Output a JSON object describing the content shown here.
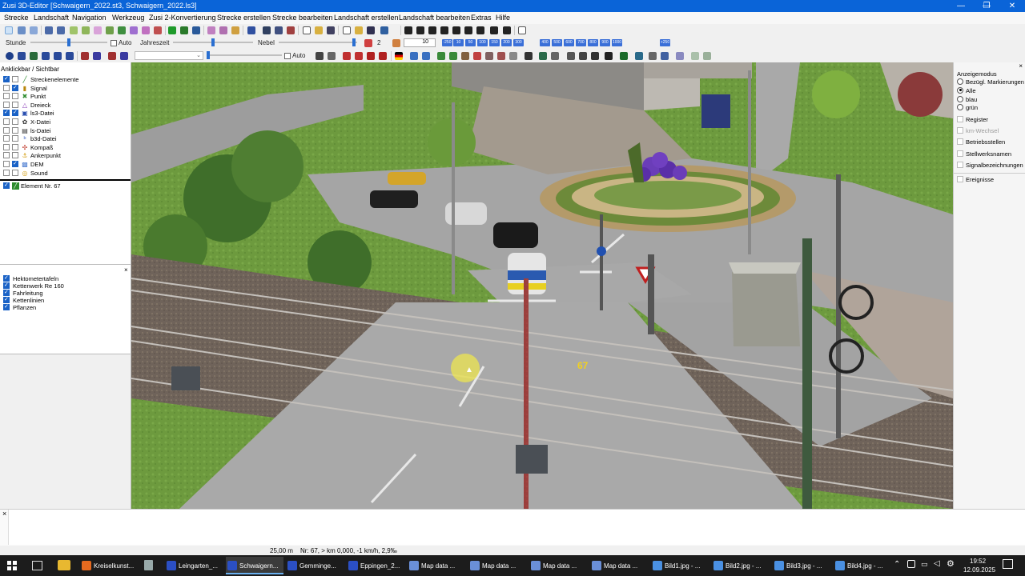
{
  "window": {
    "title": "Zusi 3D-Editor [Schwaigern_2022.st3, Schwaigern_2022.ls3]",
    "controls": [
      "—",
      "❐",
      "✕"
    ]
  },
  "menu": [
    "Strecke",
    "Landschaft",
    "Navigation",
    "Werkzeug",
    "Zusi 2-Konvertierung",
    "Strecke erstellen",
    "Strecke bearbeiten",
    "Landschaft erstellen",
    "Landschaft bearbeiten",
    "Extras",
    "Hilfe"
  ],
  "toolbar2": {
    "stunde_label": "Stunde",
    "auto_label": "Auto",
    "jahreszeit_label": "Jahreszeit",
    "nebel_label": "Nebel",
    "level_value": "2",
    "number_value": "10",
    "zoom_buttons": [
      "-250",
      "10",
      "50",
      "100",
      "150",
      "200",
      "300",
      "400",
      "500",
      "600",
      "700",
      "800",
      "900",
      "1000",
      "+250"
    ]
  },
  "toolbar3": {
    "auto_label": "Auto"
  },
  "left_panel": {
    "header": "Anklickbar / Sichtbar",
    "tree": [
      {
        "label": "Streckenelemente",
        "c1": true,
        "c2": false,
        "icon": "track-icon",
        "color": "#2e8b2e",
        "glyph": "╱"
      },
      {
        "label": "Signal",
        "c1": false,
        "c2": true,
        "icon": "signal-icon",
        "color": "#b8860b",
        "glyph": "▮"
      },
      {
        "label": "Punkt",
        "c1": false,
        "c2": false,
        "icon": "point-icon",
        "color": "#2e8b2e",
        "glyph": "✖"
      },
      {
        "label": "Dreieck",
        "c1": false,
        "c2": false,
        "icon": "triangle-icon",
        "color": "#8a3fb8",
        "glyph": "△"
      },
      {
        "label": "ls3-Datei",
        "c1": true,
        "c2": true,
        "icon": "ls3-file-icon",
        "color": "#2a4fb0",
        "glyph": "▣"
      },
      {
        "label": "X-Datei",
        "c1": false,
        "c2": false,
        "icon": "x-file-icon",
        "color": "#333333",
        "glyph": "✿"
      },
      {
        "label": "ls-Datei",
        "c1": false,
        "c2": false,
        "icon": "ls-file-icon",
        "color": "#333333",
        "glyph": "▤"
      },
      {
        "label": "b3d-Datei",
        "c1": false,
        "c2": false,
        "icon": "b3d-file-icon",
        "color": "#3b5fc0",
        "glyph": "ᵇ"
      },
      {
        "label": "Kompaß",
        "c1": false,
        "c2": false,
        "icon": "compass-icon",
        "color": "#c0392b",
        "glyph": "✣"
      },
      {
        "label": "Ankerpunkt",
        "c1": false,
        "c2": false,
        "icon": "anchor-icon",
        "color": "#d4a017",
        "glyph": "⚓"
      },
      {
        "label": "DEM",
        "c1": false,
        "c2": true,
        "icon": "dem-icon",
        "color": "#4a7bd0",
        "glyph": "▩"
      },
      {
        "label": "Sound",
        "c1": false,
        "c2": false,
        "icon": "sound-icon",
        "color": "#d4a017",
        "glyph": "◎"
      }
    ],
    "element_label": "Element Nr. 67",
    "layers": [
      {
        "label": "Hektometertafeln",
        "checked": true
      },
      {
        "label": "Kettenwerk Re 160",
        "checked": true
      },
      {
        "label": "Fahrleitung",
        "checked": true
      },
      {
        "label": "Kettenlinien",
        "checked": true
      },
      {
        "label": "Pflanzen",
        "checked": true
      }
    ]
  },
  "viewport": {
    "element_number": "67"
  },
  "right_panel": {
    "anzeigemodus_label": "Anzeigemodus",
    "radios": [
      {
        "label": "Bezügl. Markierungen",
        "checked": false
      },
      {
        "label": "Alle",
        "checked": true
      },
      {
        "label": "blau",
        "checked": false
      },
      {
        "label": "grün",
        "checked": false
      }
    ],
    "checks": [
      {
        "label": "Register",
        "enabled": true
      },
      {
        "label": "km-Wechsel",
        "enabled": false
      },
      {
        "label": "Betriebsstellen",
        "enabled": true
      },
      {
        "label": "Stellwerksnamen",
        "enabled": true
      },
      {
        "label": "Signalbezeichnungen",
        "enabled": true
      }
    ],
    "ereignisse_label": "Ereignisse"
  },
  "status": {
    "distance": "25,00 m",
    "info": "Nr: 67, > km 0,000, -1 km/h, 2,9‰"
  },
  "taskbar": {
    "items": [
      {
        "label": "Kreiselkunst...",
        "color": "#e66a1f",
        "active": false
      },
      {
        "label": "Leingarten_...",
        "color": "#2b4fc4",
        "active": false
      },
      {
        "label": "Schwaigern...",
        "color": "#2b4fc4",
        "active": true
      },
      {
        "label": "Gemminge...",
        "color": "#2b4fc4",
        "active": false
      },
      {
        "label": "Eppingen_2...",
        "color": "#2b4fc4",
        "active": false
      },
      {
        "label": "Map data ...",
        "color": "#6a8fd8",
        "active": false
      },
      {
        "label": "Map data ...",
        "color": "#6a8fd8",
        "active": false
      },
      {
        "label": "Map data ...",
        "color": "#6a8fd8",
        "active": false
      },
      {
        "label": "Map data ...",
        "color": "#6a8fd8",
        "active": false
      },
      {
        "label": "Bild1.jpg - ...",
        "color": "#4a90e2",
        "active": false
      },
      {
        "label": "Bild2.jpg - ...",
        "color": "#4a90e2",
        "active": false
      },
      {
        "label": "Bild3.jpg - ...",
        "color": "#4a90e2",
        "active": false
      },
      {
        "label": "Bild4.jpg - ...",
        "color": "#4a90e2",
        "active": false
      }
    ],
    "time": "19:52",
    "date": "12.09.2025"
  }
}
